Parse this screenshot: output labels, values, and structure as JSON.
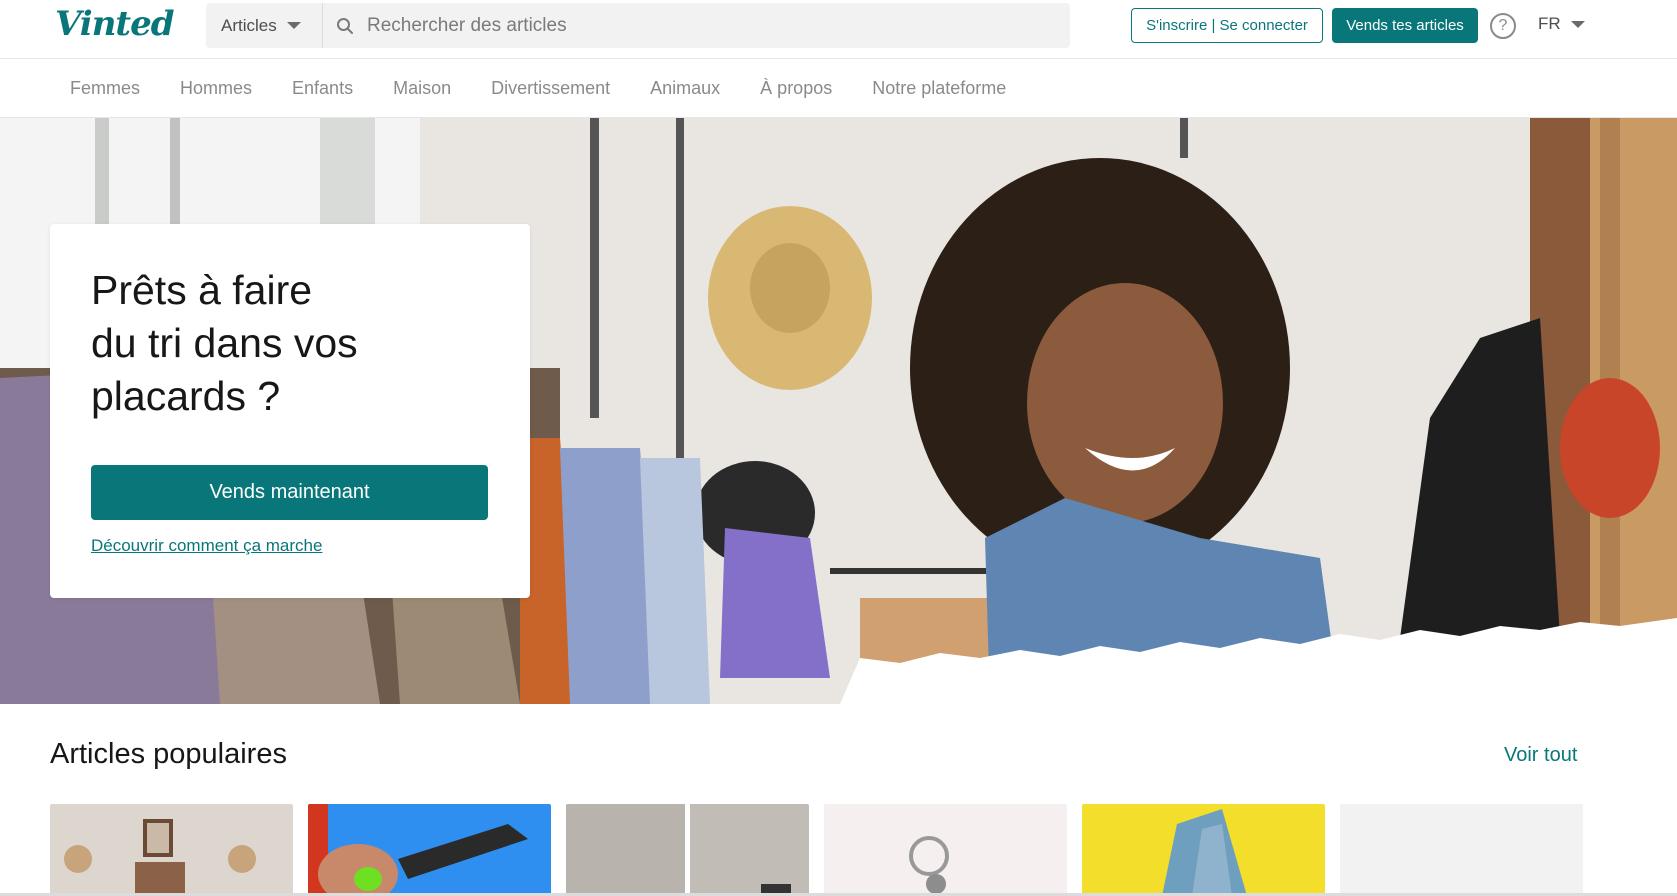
{
  "header": {
    "logo": "Vinted",
    "search_category": "Articles",
    "search_placeholder": "Rechercher des articles",
    "login_label": "S'inscrire | Se connecter",
    "sell_label": "Vends tes articles",
    "help_symbol": "?",
    "language": "FR"
  },
  "nav": {
    "items": [
      "Femmes",
      "Hommes",
      "Enfants",
      "Maison",
      "Divertissement",
      "Animaux",
      "À propos",
      "Notre plateforme"
    ]
  },
  "hero": {
    "title_line1": "Prêts à faire",
    "title_line2": "du tri dans vos",
    "title_line3": "placards ?",
    "cta_label": "Vends maintenant",
    "link_label": "Découvrir comment ça marche"
  },
  "popular": {
    "title": "Articles populaires",
    "see_all": "Voir tout"
  },
  "colors": {
    "brand": "#09777a",
    "text": "#171717",
    "muted": "#8a8a8a"
  },
  "icons": {
    "search": "search-icon",
    "caret": "chevron-down-icon",
    "help": "help-icon"
  }
}
